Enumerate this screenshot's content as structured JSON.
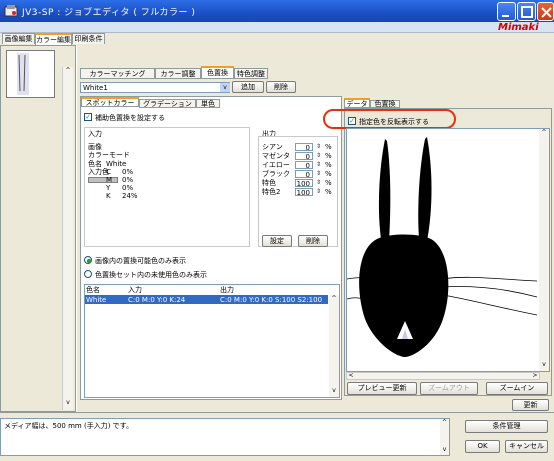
{
  "window": {
    "title": "JV3-SP : ジョブエディタ ( フルカラー )",
    "brand": "Mimaki",
    "title_bar_color": "#1c4fc4",
    "brand_color": "#d00000",
    "highlight_color": "#e53010"
  },
  "top_tabs": [
    "画像編集",
    "カラー編集",
    "印刷条件"
  ],
  "sub_tabs": [
    "カラーマッチング",
    "カラー調整",
    "色置換",
    "特色調整"
  ],
  "color_select": {
    "value": "White1",
    "add_label": "追加",
    "delete_label": "削除"
  },
  "tool_tabs": [
    "スポットカラー",
    "グラデーション",
    "単色"
  ],
  "assist_checkbox_label": "補助色置換を設定する",
  "input": {
    "header": "入力",
    "image_label": "画像",
    "color_mode_label": "カラーモード",
    "color_name_label": "色名",
    "color_name_value": "White",
    "input_color_label": "入力色",
    "cmyk": [
      {
        "channel": "C",
        "value": "0%"
      },
      {
        "channel": "M",
        "value": "0%"
      },
      {
        "channel": "Y",
        "value": "0%"
      },
      {
        "channel": "K",
        "value": "24%"
      }
    ]
  },
  "output": {
    "header": "出力",
    "rows": [
      {
        "label": "シアン",
        "value": "0",
        "unit": "%"
      },
      {
        "label": "マゼンタ",
        "value": "0",
        "unit": "%"
      },
      {
        "label": "イエロー",
        "value": "0",
        "unit": "%"
      },
      {
        "label": "ブラック",
        "value": "0",
        "unit": "%"
      },
      {
        "label": "特色",
        "value": "100",
        "unit": "%"
      },
      {
        "label": "特色2",
        "value": "100",
        "unit": "%"
      }
    ],
    "set_label": "設定",
    "delete_label": "削除"
  },
  "radios": [
    {
      "label": "画像内の置換可能色のみ表示",
      "selected": true
    },
    {
      "label": "色置換セット内の未使用色のみ表示",
      "selected": false
    }
  ],
  "list": {
    "headers": [
      "色名",
      "入力",
      "出力"
    ],
    "rows": [
      {
        "name": "White",
        "input": "C:0 M:0 Y:0 K:24",
        "output": "C:0 M:0 Y:0 K:0 S:100 S2:100"
      }
    ]
  },
  "preview": {
    "tabs": [
      "データ",
      "色置換"
    ],
    "invert_checkbox_label": "指定色を反転表示する",
    "update_label": "プレビュー更新",
    "zoom_out_label": "ズームアウト",
    "zoom_in_label": "ズームイン"
  },
  "refresh_label": "更新",
  "status": {
    "message": "メディア幅は、500 mm (手入力) です。",
    "condition_label": "条件管理",
    "ok_label": "OK",
    "cancel_label": "キャンセル"
  }
}
